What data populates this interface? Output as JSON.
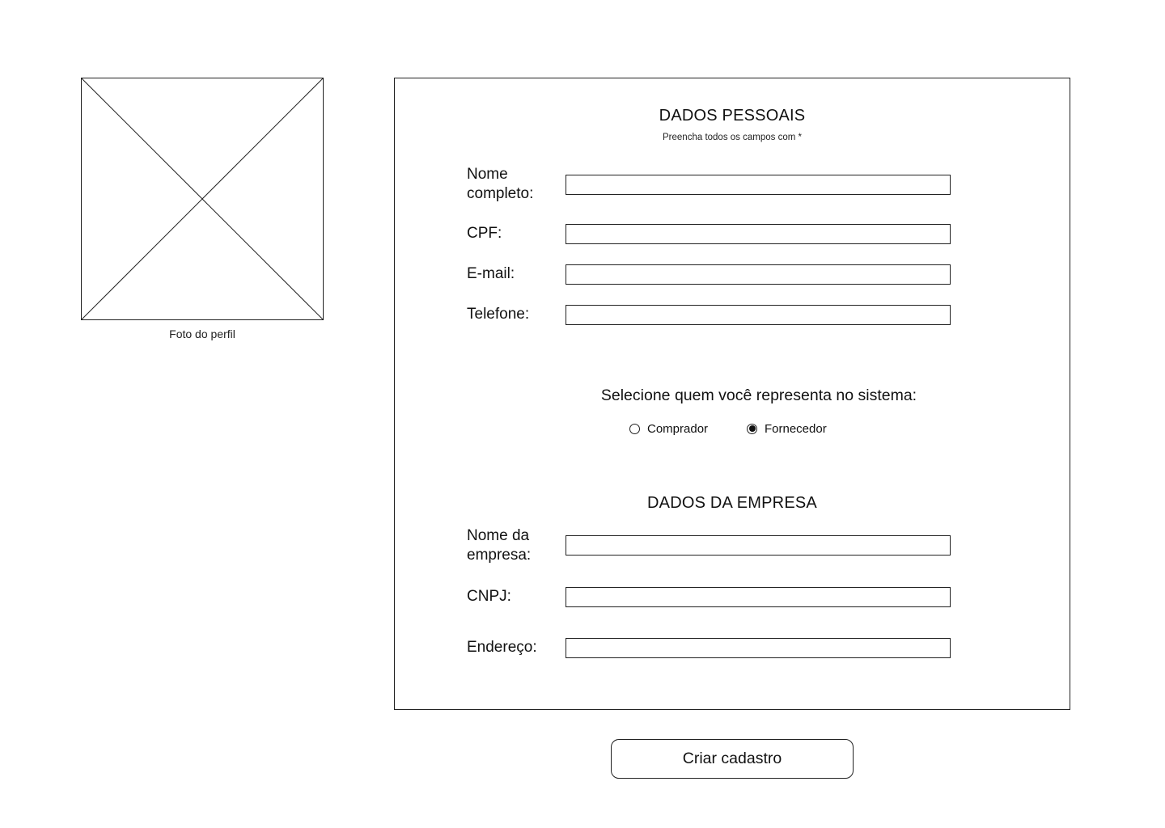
{
  "profile": {
    "caption": "Foto do perfil"
  },
  "personal": {
    "title": "DADOS PESSOAIS",
    "subtitle": "Preencha todos os campos com *",
    "fields": [
      {
        "label": "Nome completo:",
        "value": ""
      },
      {
        "label": "CPF:",
        "value": ""
      },
      {
        "label": "E-mail:",
        "value": ""
      },
      {
        "label": "Telefone:",
        "value": ""
      }
    ]
  },
  "role": {
    "question": "Selecione quem você representa no sistema:",
    "options": [
      {
        "label": "Comprador",
        "selected": false
      },
      {
        "label": "Fornecedor",
        "selected": true
      }
    ]
  },
  "company": {
    "title": "DADOS DA EMPRESA",
    "fields": [
      {
        "label": "Nome da empresa:",
        "value": ""
      },
      {
        "label": "CNPJ:",
        "value": ""
      },
      {
        "label": "Endereço:",
        "value": ""
      }
    ]
  },
  "submit": {
    "label": "Criar cadastro"
  }
}
